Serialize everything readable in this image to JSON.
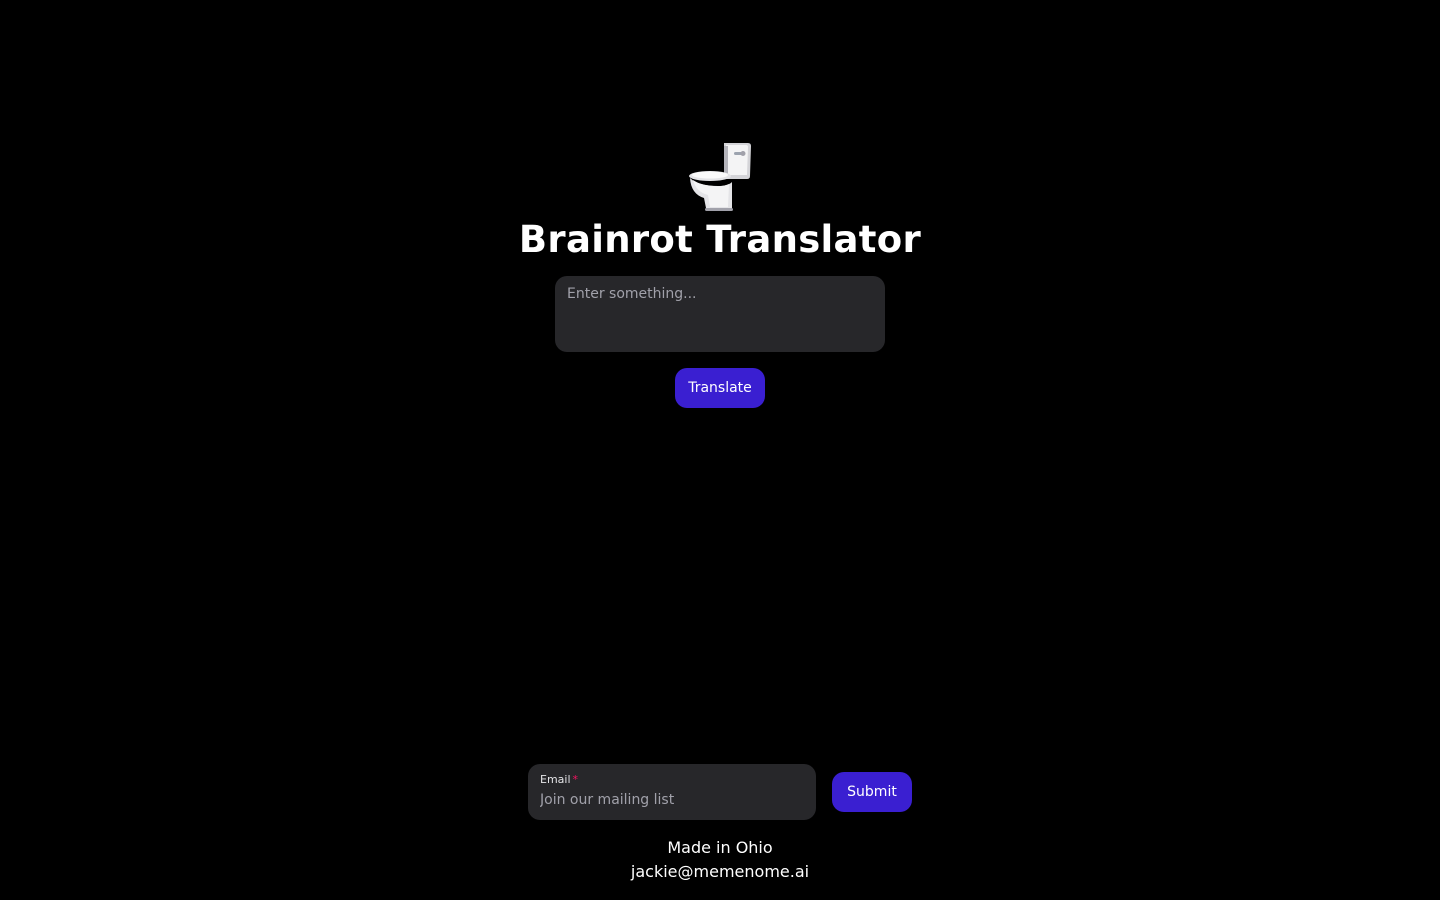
{
  "app": {
    "title": "Brainrot Translator",
    "logo_icon": "toilet-icon"
  },
  "translator": {
    "input_value": "",
    "input_placeholder": "Enter something...",
    "translate_label": "Translate"
  },
  "mailing": {
    "email_label": "Email",
    "required_marker": "*",
    "email_value": "",
    "email_placeholder": "Join our mailing list",
    "submit_label": "Submit"
  },
  "footer": {
    "made_in": "Made in Ohio",
    "contact_email": "jackie@memenome.ai"
  },
  "colors": {
    "background": "#000000",
    "field_background": "#27272a",
    "accent": "#3a1fd1",
    "required": "#f31260"
  }
}
